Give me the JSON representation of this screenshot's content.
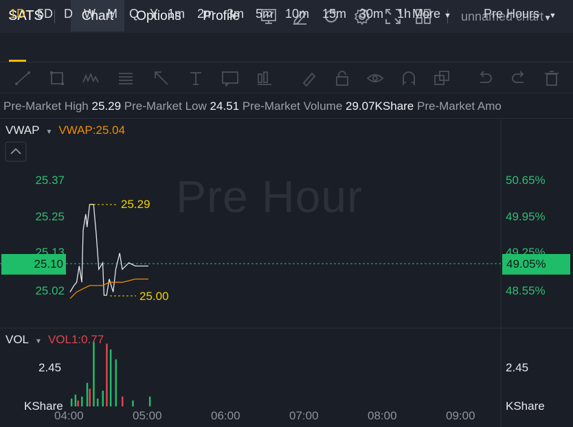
{
  "ticker": "SATS",
  "tabs": [
    "Chart",
    "Options",
    "Profile"
  ],
  "chart_name": "unnamed chart",
  "timeframes": [
    "1D",
    "5D",
    "D",
    "W",
    "M",
    "Q",
    "Y",
    "1m",
    "2m",
    "3m",
    "5m",
    "10m",
    "15m",
    "30m",
    "1h"
  ],
  "more_label": "More",
  "session": "Pre Hours",
  "stats": {
    "high_label": "Pre-Market High",
    "high_value": "25.29",
    "low_label": "Pre-Market Low",
    "low_value": "24.51",
    "volume_label": "Pre-Market Volume",
    "volume_value": "29.07KShare",
    "amount_label": "Pre-Market Amo"
  },
  "indicator": {
    "name": "VWAP",
    "value": "VWAP:25.04"
  },
  "watermark": "Pre Hour",
  "price_axis": [
    "25.37",
    "25.25",
    "25.13",
    "25.02"
  ],
  "percent_axis": [
    "50.65%",
    "49.95%",
    "49.25%",
    "48.55%"
  ],
  "current_price": "25.10",
  "current_percent": "49.05%",
  "high_marker": "25.29",
  "low_marker": "25.00",
  "volume_panel": {
    "name": "VOL",
    "value": "VOL1:0.77",
    "axis_value": "2.45",
    "unit": "KShare"
  },
  "time_axis": [
    "04:00",
    "05:00",
    "06:00",
    "07:00",
    "08:00",
    "09:00"
  ],
  "colors": {
    "accent": "#f0b90b",
    "up": "#1fbd6a",
    "down": "#e0454f",
    "vwap": "#f08c00",
    "price_line": "#e6e8ec"
  },
  "chart_data": {
    "type": "line",
    "title": "",
    "x_range": [
      "04:00",
      "09:00"
    ],
    "ylim": [
      24.97,
      25.41
    ],
    "series": [
      {
        "name": "",
        "x": [
          "04:00",
          "04:03",
          "04:05",
          "04:07",
          "04:09",
          "04:10",
          "04:12",
          "04:13",
          "04:15",
          "04:18",
          "04:20",
          "04:22",
          "04:25",
          "04:26",
          "04:28",
          "04:30",
          "04:33",
          "04:35",
          "04:38",
          "04:40",
          "04:45",
          "04:50",
          "04:55",
          "05:00"
        ],
        "values": [
          25.02,
          25.04,
          25.05,
          25.1,
          25.05,
          25.21,
          25.26,
          25.22,
          25.29,
          25.29,
          25.2,
          25.09,
          25.11,
          25.01,
          25.01,
          25.06,
          25.02,
          25.09,
          25.14,
          25.09,
          25.11,
          25.1,
          25.1,
          25.1
        ]
      },
      {
        "name": "VWAP",
        "x": [
          "04:00",
          "04:05",
          "04:10",
          "04:15",
          "04:20",
          "04:25",
          "04:30",
          "04:35",
          "04:40",
          "04:50",
          "05:00"
        ],
        "values": [
          25.0,
          25.02,
          25.03,
          25.04,
          25.04,
          25.04,
          25.05,
          25.05,
          25.05,
          25.06,
          25.06
        ]
      }
    ],
    "volume": {
      "x": [
        "04:01",
        "04:04",
        "04:06",
        "04:09",
        "04:13",
        "04:15",
        "04:18",
        "04:21",
        "04:25",
        "04:28",
        "04:31",
        "04:35",
        "04:40",
        "04:48",
        "05:01"
      ],
      "values": [
        0.4,
        0.6,
        0.3,
        0.5,
        1.2,
        0.9,
        3.3,
        0.4,
        0.8,
        3.2,
        2.9,
        2.4,
        0.5,
        0.3,
        0.5
      ],
      "direction": [
        "up",
        "up",
        "down",
        "up",
        "up",
        "down",
        "up",
        "up",
        "up",
        "down",
        "up",
        "up",
        "down",
        "up",
        "up"
      ]
    }
  }
}
